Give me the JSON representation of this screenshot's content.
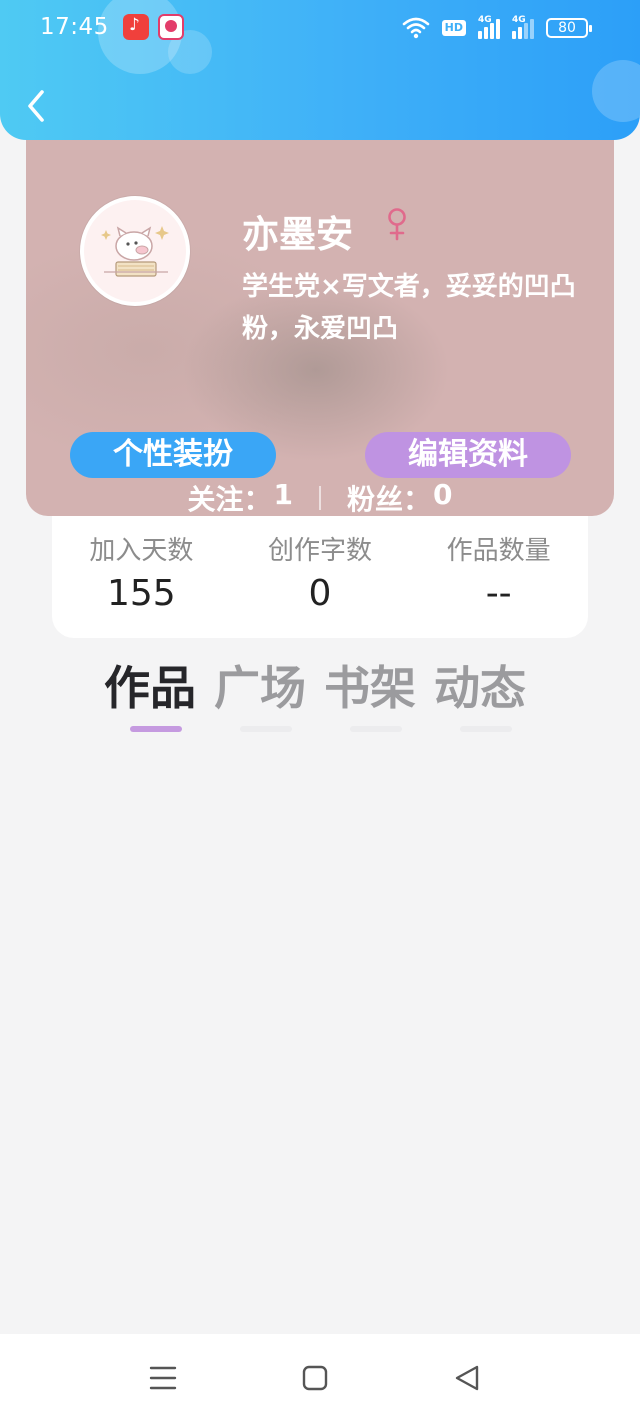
{
  "status_bar": {
    "time": "17:45",
    "hd_label": "HD",
    "network_1": "4G",
    "network_2": "4G",
    "battery": "80"
  },
  "profile": {
    "username": "亦墨安",
    "gender_icon": "female-icon",
    "bio": "学生党×写文者，妥妥的凹凸粉，永爱凹凸",
    "decorate_button": "个性装扮",
    "edit_button": "编辑资料",
    "following_label": "关注：",
    "following_count": "1",
    "followers_label": "粉丝：",
    "followers_count": "0"
  },
  "stats": [
    {
      "label": "加入天数",
      "value": "155"
    },
    {
      "label": "创作字数",
      "value": "0"
    },
    {
      "label": "作品数量",
      "value": "--"
    }
  ],
  "tabs": [
    {
      "label": "作品",
      "active": true
    },
    {
      "label": "广场",
      "active": false
    },
    {
      "label": "书架",
      "active": false
    },
    {
      "label": "动态",
      "active": false
    }
  ],
  "colors": {
    "header_blue": "#3fb0f8",
    "decorate_button_blue": "#3aa6f6",
    "edit_button_purple": "#bf93e2",
    "tab_underline_active": "#c59ae0",
    "card_background": "#d3b2b1",
    "gender_pink": "#e06a8c"
  },
  "nav": {
    "icons": [
      "menu-icon",
      "home-square-icon",
      "back-triangle-icon"
    ]
  }
}
